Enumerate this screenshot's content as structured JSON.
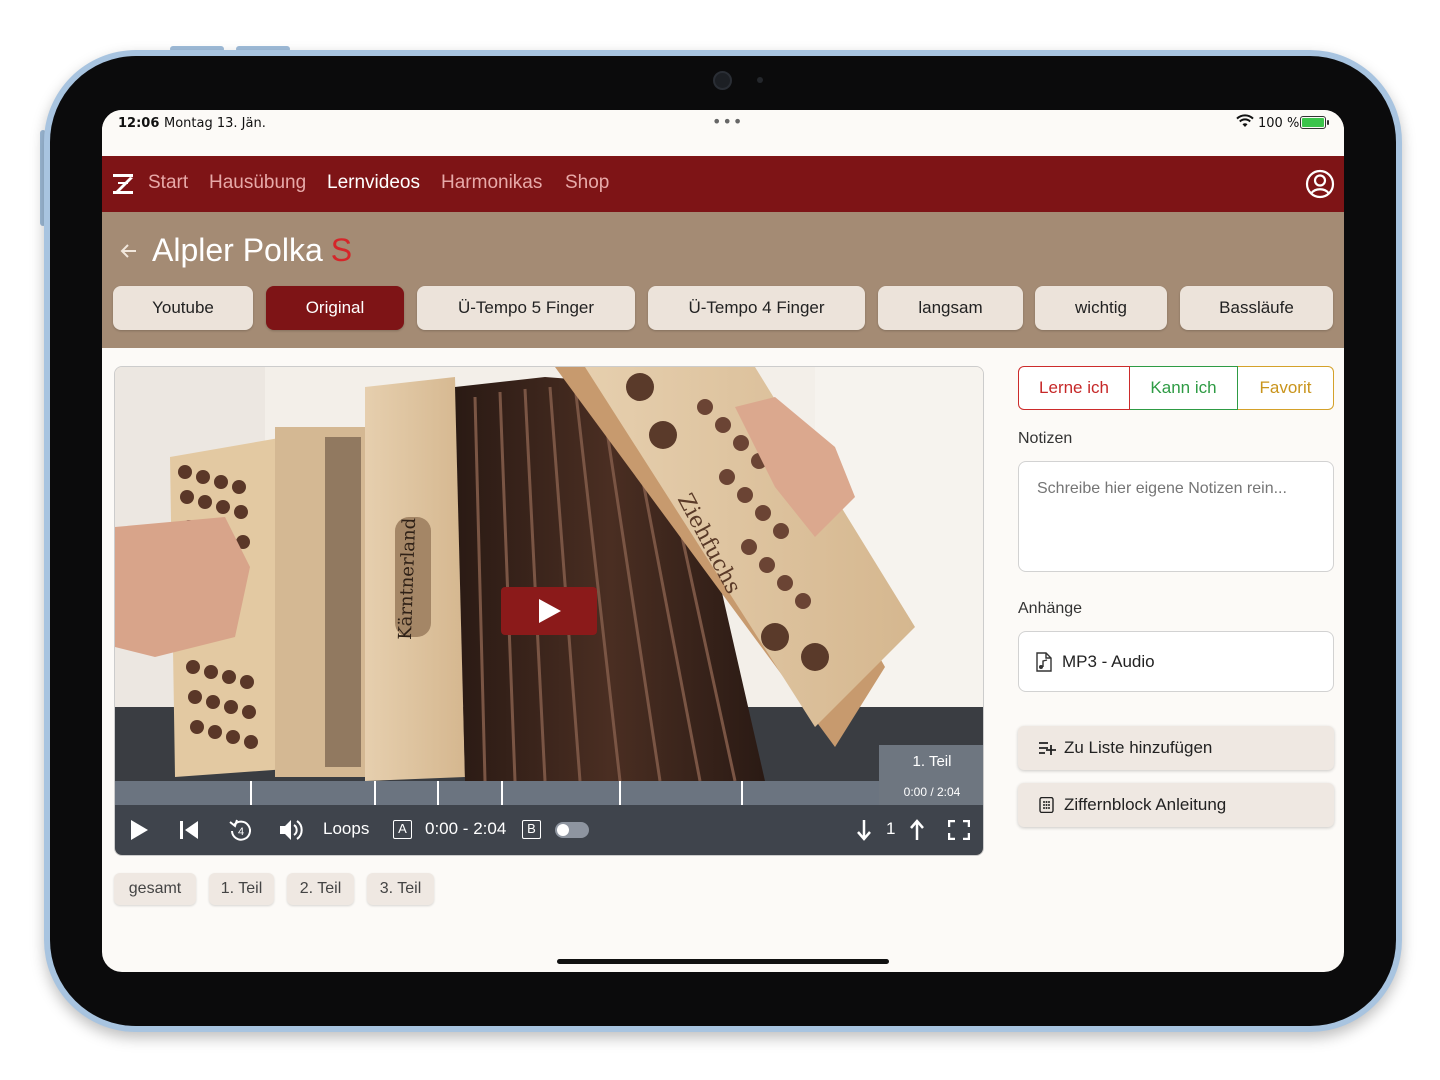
{
  "status_bar": {
    "time": "12:06",
    "date": "Montag 13. Jän.",
    "battery": "100 %"
  },
  "nav": {
    "items": [
      {
        "label": "Start"
      },
      {
        "label": "Hausübung"
      },
      {
        "label": "Lernvideos"
      },
      {
        "label": "Harmonikas"
      },
      {
        "label": "Shop"
      }
    ],
    "active": "Lernvideos",
    "brand_color": "#7e1416"
  },
  "page": {
    "title": "Alpler Polka",
    "title_badge": "S"
  },
  "video_tabs": [
    {
      "label": "Youtube"
    },
    {
      "label": "Original"
    },
    {
      "label": "Ü-Tempo 5 Finger"
    },
    {
      "label": "Ü-Tempo 4 Finger"
    },
    {
      "label": "langsam"
    },
    {
      "label": "wichtig"
    },
    {
      "label": "Bassläufe"
    }
  ],
  "active_tab": "Original",
  "player": {
    "part_popup_name": "1. Teil",
    "part_popup_time": "0:00 / 2:04",
    "loops_label": "Loops",
    "a_label": "A",
    "b_label": "B",
    "loop_range": "0:00 - 2:04",
    "replay_seconds": "4",
    "count": "1",
    "accordion_text": "Kärntnerland",
    "accordion_text2": "Ziehfuchs"
  },
  "parts": [
    {
      "label": "gesamt"
    },
    {
      "label": "1. Teil"
    },
    {
      "label": "2. Teil"
    },
    {
      "label": "3. Teil"
    }
  ],
  "status_buttons": {
    "lerne": "Lerne ich",
    "kann": "Kann ich",
    "favorit": "Favorit"
  },
  "notes": {
    "label": "Notizen",
    "placeholder": "Schreibe hier eigene Notizen rein..."
  },
  "attachments": {
    "label": "Anhänge",
    "items": [
      {
        "label": "MP3 - Audio"
      }
    ]
  },
  "actions": {
    "add_to_list": "Zu Liste hinzufügen",
    "numpad_guide": "Ziffernblock Anleitung"
  }
}
